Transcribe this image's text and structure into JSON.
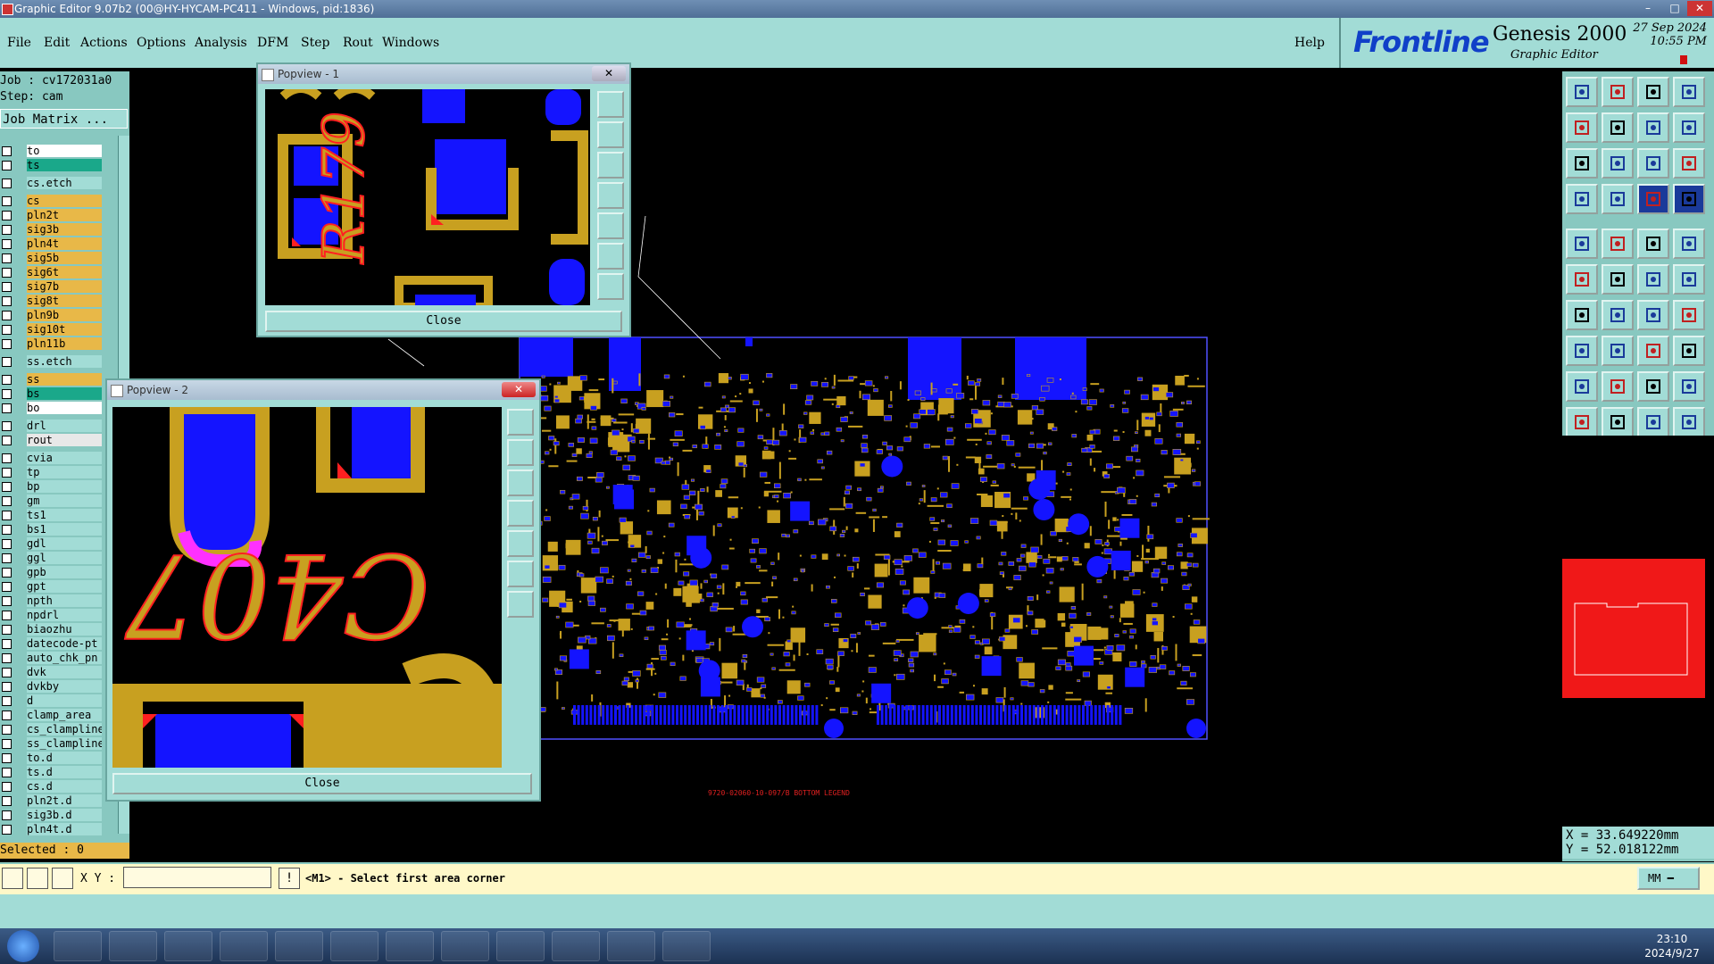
{
  "window": {
    "title": "Graphic Editor 9.07b2 (00@HY-HYCAM-PC411 - Windows, pid:1836)"
  },
  "menu": [
    {
      "label": "File",
      "name": "menu-file"
    },
    {
      "label": "Edit",
      "name": "menu-edit"
    },
    {
      "label": "Actions",
      "name": "menu-actions"
    },
    {
      "label": "Options",
      "name": "menu-options"
    },
    {
      "label": "Analysis",
      "name": "menu-analysis"
    },
    {
      "label": "DFM",
      "name": "menu-dfm"
    },
    {
      "label": "Step",
      "name": "menu-step"
    },
    {
      "label": "Rout",
      "name": "menu-rout"
    },
    {
      "label": "Windows",
      "name": "menu-windows"
    }
  ],
  "help_label": "Help",
  "brand": {
    "logo": "Frontline",
    "product": "Genesis 2000",
    "subtitle": "Graphic Editor",
    "date": "27 Sep 2024",
    "time": "10:55 PM"
  },
  "job": {
    "job_line": "Job : cv172031a0",
    "step_line": "Step: cam",
    "matrix_button": "Job Matrix ..."
  },
  "layers": [
    {
      "name": "to",
      "color": "#ffffff"
    },
    {
      "name": "ts",
      "color": "#1aa88a"
    },
    {
      "name": "cs.etch",
      "color": "#a2dcd6"
    },
    {
      "name": "cs",
      "color": "#e8b848"
    },
    {
      "name": "pln2t",
      "color": "#e8b848"
    },
    {
      "name": "sig3b",
      "color": "#e8b848"
    },
    {
      "name": "pln4t",
      "color": "#e8b848"
    },
    {
      "name": "sig5b",
      "color": "#e8b848"
    },
    {
      "name": "sig6t",
      "color": "#e8b848"
    },
    {
      "name": "sig7b",
      "color": "#e8b848"
    },
    {
      "name": "sig8t",
      "color": "#e8b848"
    },
    {
      "name": "pln9b",
      "color": "#e8b848"
    },
    {
      "name": "sig10t",
      "color": "#e8b848"
    },
    {
      "name": "pln11b",
      "color": "#e8b848"
    },
    {
      "name": "ss.etch",
      "color": "#a2dcd6"
    },
    {
      "name": "ss",
      "color": "#e8b848"
    },
    {
      "name": "bs",
      "color": "#1aa88a"
    },
    {
      "name": "bo",
      "color": "#ffffff"
    },
    {
      "name": "drl",
      "color": "#a2dcd6"
    },
    {
      "name": "rout",
      "color": "#e8e8e8"
    },
    {
      "name": "cvia",
      "color": "#a2dcd6"
    },
    {
      "name": "tp",
      "color": "#a2dcd6"
    },
    {
      "name": "bp",
      "color": "#a2dcd6"
    },
    {
      "name": "gm",
      "color": "#a2dcd6"
    },
    {
      "name": "ts1",
      "color": "#a2dcd6"
    },
    {
      "name": "bs1",
      "color": "#a2dcd6"
    },
    {
      "name": "gdl",
      "color": "#a2dcd6"
    },
    {
      "name": "ggl",
      "color": "#a2dcd6"
    },
    {
      "name": "gpb",
      "color": "#a2dcd6"
    },
    {
      "name": "gpt",
      "color": "#a2dcd6"
    },
    {
      "name": "npth",
      "color": "#a2dcd6"
    },
    {
      "name": "npdrl",
      "color": "#a2dcd6"
    },
    {
      "name": "biaozhu",
      "color": "#a2dcd6"
    },
    {
      "name": "datecode-pt",
      "color": "#a2dcd6"
    },
    {
      "name": "auto_chk_pn",
      "color": "#a2dcd6"
    },
    {
      "name": "dvk",
      "color": "#a2dcd6"
    },
    {
      "name": "dvkby",
      "color": "#a2dcd6"
    },
    {
      "name": "d",
      "color": "#a2dcd6"
    },
    {
      "name": "clamp_area",
      "color": "#a2dcd6"
    },
    {
      "name": "cs_clampline",
      "color": "#a2dcd6"
    },
    {
      "name": "ss_clampline",
      "color": "#a2dcd6"
    },
    {
      "name": "to.d",
      "color": "#a2dcd6"
    },
    {
      "name": "ts.d",
      "color": "#a2dcd6"
    },
    {
      "name": "cs.d",
      "color": "#a2dcd6"
    },
    {
      "name": "pln2t.d",
      "color": "#a2dcd6"
    },
    {
      "name": "sig3b.d",
      "color": "#a2dcd6"
    },
    {
      "name": "pln4t.d",
      "color": "#a2dcd6"
    }
  ],
  "selected_label": "Selected : 0",
  "popview1": {
    "title": "Popview - 1",
    "close_label": "Close",
    "label_text": "R179"
  },
  "popview2": {
    "title": "Popview - 2",
    "close_label": "Close",
    "label_text": "C407"
  },
  "board_caption": "9720-02060-10-097/B BOTTOM LEGEND",
  "coords": {
    "x": "X = 33.649220mm",
    "y": "Y = 52.018122mm"
  },
  "status": {
    "xy_label": "X Y :",
    "xy_value": "",
    "message": "<M1> - Select first area corner",
    "units": "MM"
  },
  "taskbar": {
    "time": "23:10",
    "date": "2024/9/27"
  },
  "colors": {
    "panel": "#a2dcd6",
    "copper": "#c8a020",
    "pad": "#1414ff",
    "highlight": "#e8b848",
    "board_outline": "#5050ff"
  }
}
